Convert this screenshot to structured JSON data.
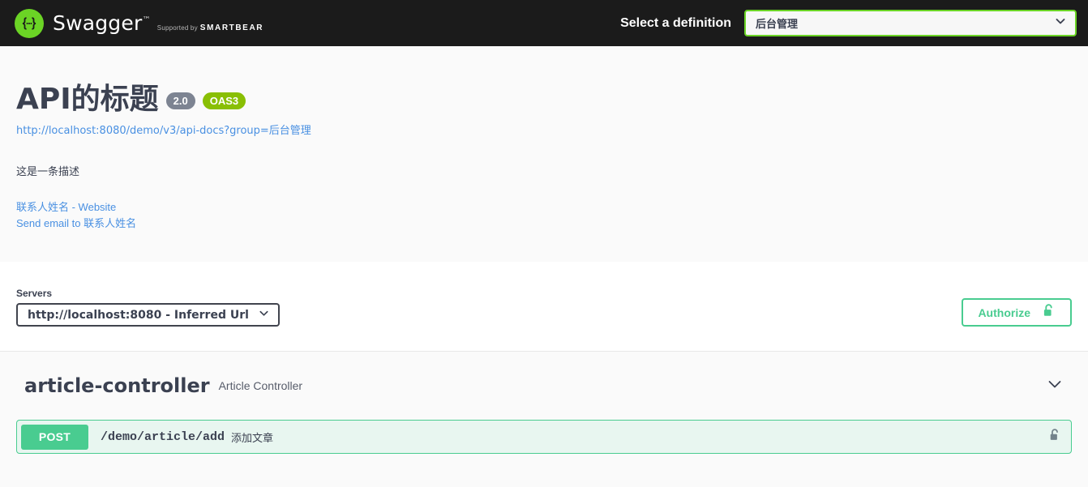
{
  "topbar": {
    "logo": {
      "icon": "swagger-braces-icon",
      "name": "Swagger",
      "trademark": "™",
      "supported_by_prefix": "Supported by",
      "supported_by_brand": "SMARTBEAR"
    },
    "definition_label": "Select a definition",
    "definition_select": {
      "value": "后台管理",
      "icon": "chevron-down-icon"
    },
    "background_color": "#1b1b1b",
    "accent_color": "#6bd425"
  },
  "info": {
    "title": "API的标题",
    "badges": [
      {
        "label": "2.0",
        "color": "#7d8492"
      },
      {
        "label": "OAS3",
        "color": "#89bf04"
      }
    ],
    "url": "http://localhost:8080/demo/v3/api-docs?group=后台管理",
    "description": "这是一条描述",
    "contact_website_link": "联系人姓名 - Website",
    "contact_email_link": "Send email to 联系人姓名",
    "link_color": "#4990e2"
  },
  "servers": {
    "label": "Servers",
    "selected": "http://localhost:8080 - Inferred Url",
    "chevron_icon": "chevron-down-icon",
    "authorize": {
      "label": "Authorize",
      "icon": "unlock-icon",
      "color": "#49cc90"
    }
  },
  "tags": [
    {
      "name": "article-controller",
      "description": "Article Controller",
      "expand_icon": "chevron-down-icon",
      "operations": [
        {
          "method": "POST",
          "path": "/demo/article/add",
          "summary": "添加文章",
          "lock_icon": "unlock-icon",
          "method_color": "#49cc90",
          "background_color": "#e8f6f0"
        }
      ]
    }
  ]
}
